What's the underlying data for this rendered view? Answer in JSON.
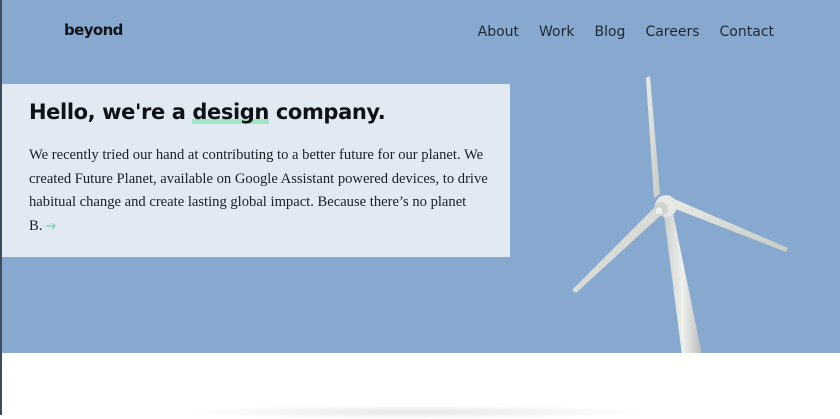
{
  "brand": {
    "logo": "beyond"
  },
  "nav": {
    "items": [
      {
        "label": "About"
      },
      {
        "label": "Work"
      },
      {
        "label": "Blog"
      },
      {
        "label": "Careers"
      },
      {
        "label": "Contact"
      }
    ]
  },
  "hero": {
    "headline_before": "Hello, we're a ",
    "headline_highlight": "design",
    "headline_after": " company.",
    "body": "We recently tried our hand at contributing to a better future for our planet. We created Future Planet, available on Google Assistant powered devices, to drive habitual change and create lasting global impact. Because there’s no planet B.",
    "arrow_icon": "arrow-right-icon"
  },
  "colors": {
    "hero_background": "#88a9cf",
    "card_background": "#e1e9f3",
    "highlight": "#9fe6c6",
    "arrow": "#5fd6a3"
  }
}
